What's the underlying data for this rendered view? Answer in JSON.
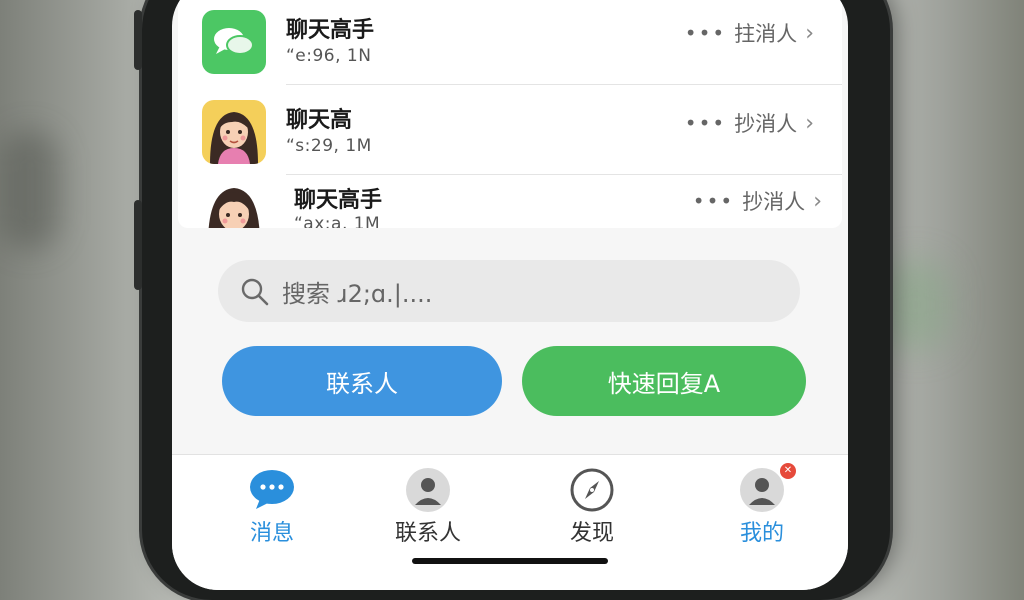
{
  "chats": [
    {
      "name": "聊天高手",
      "preview": "“e:96, 1N",
      "action": "拄消人"
    },
    {
      "name": "聊天高",
      "preview": "“s:29, 1M",
      "action": "抄消人"
    },
    {
      "name": "聊天高手",
      "preview": "“ax:a, 1M",
      "action": "抄消人"
    }
  ],
  "search": {
    "placeholder": "搜索 ɹ2;ɑ.|...."
  },
  "buttons": {
    "contacts": "联系人",
    "quick_reply": "快速回复A"
  },
  "tabs": [
    {
      "label": "消息",
      "icon": "chat-bubble-icon",
      "active": true
    },
    {
      "label": "联系人",
      "icon": "person-icon"
    },
    {
      "label": "发现",
      "icon": "compass-icon"
    },
    {
      "label": "我的",
      "icon": "profile-icon",
      "badge": "✕"
    }
  ],
  "colors": {
    "blue": "#3f95e0",
    "green": "#4bbd5e",
    "active_tab": "#2a8fdc"
  }
}
